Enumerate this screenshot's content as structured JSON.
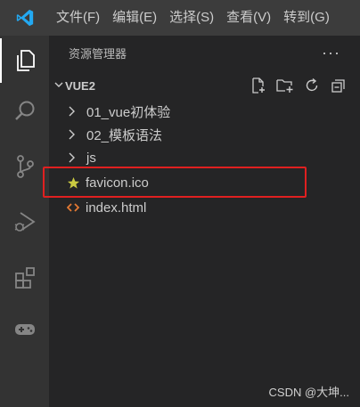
{
  "menu": [
    "文件(F)",
    "编辑(E)",
    "选择(S)",
    "查看(V)",
    "转到(G)"
  ],
  "sidebar": {
    "title": "资源管理器",
    "more": "···"
  },
  "section": {
    "title": "VUE2"
  },
  "tree": [
    {
      "label": "01_vue初体验",
      "type": "folder"
    },
    {
      "label": "02_模板语法",
      "type": "folder"
    },
    {
      "label": "js",
      "type": "folder"
    },
    {
      "label": "favicon.ico",
      "type": "file",
      "icon": "star-icon"
    },
    {
      "label": "index.html",
      "type": "file",
      "icon": "html-icon"
    }
  ],
  "colors": {
    "titlebar": "#3c3c3c",
    "activitybar": "#333333",
    "sidebar": "#252526",
    "highlight_border": "#e02020",
    "vscode_blue": "#23a9f2",
    "favicon_star": "#cbcb41",
    "html_icon": "#e37933"
  },
  "watermark": "CSDN @大坤..."
}
